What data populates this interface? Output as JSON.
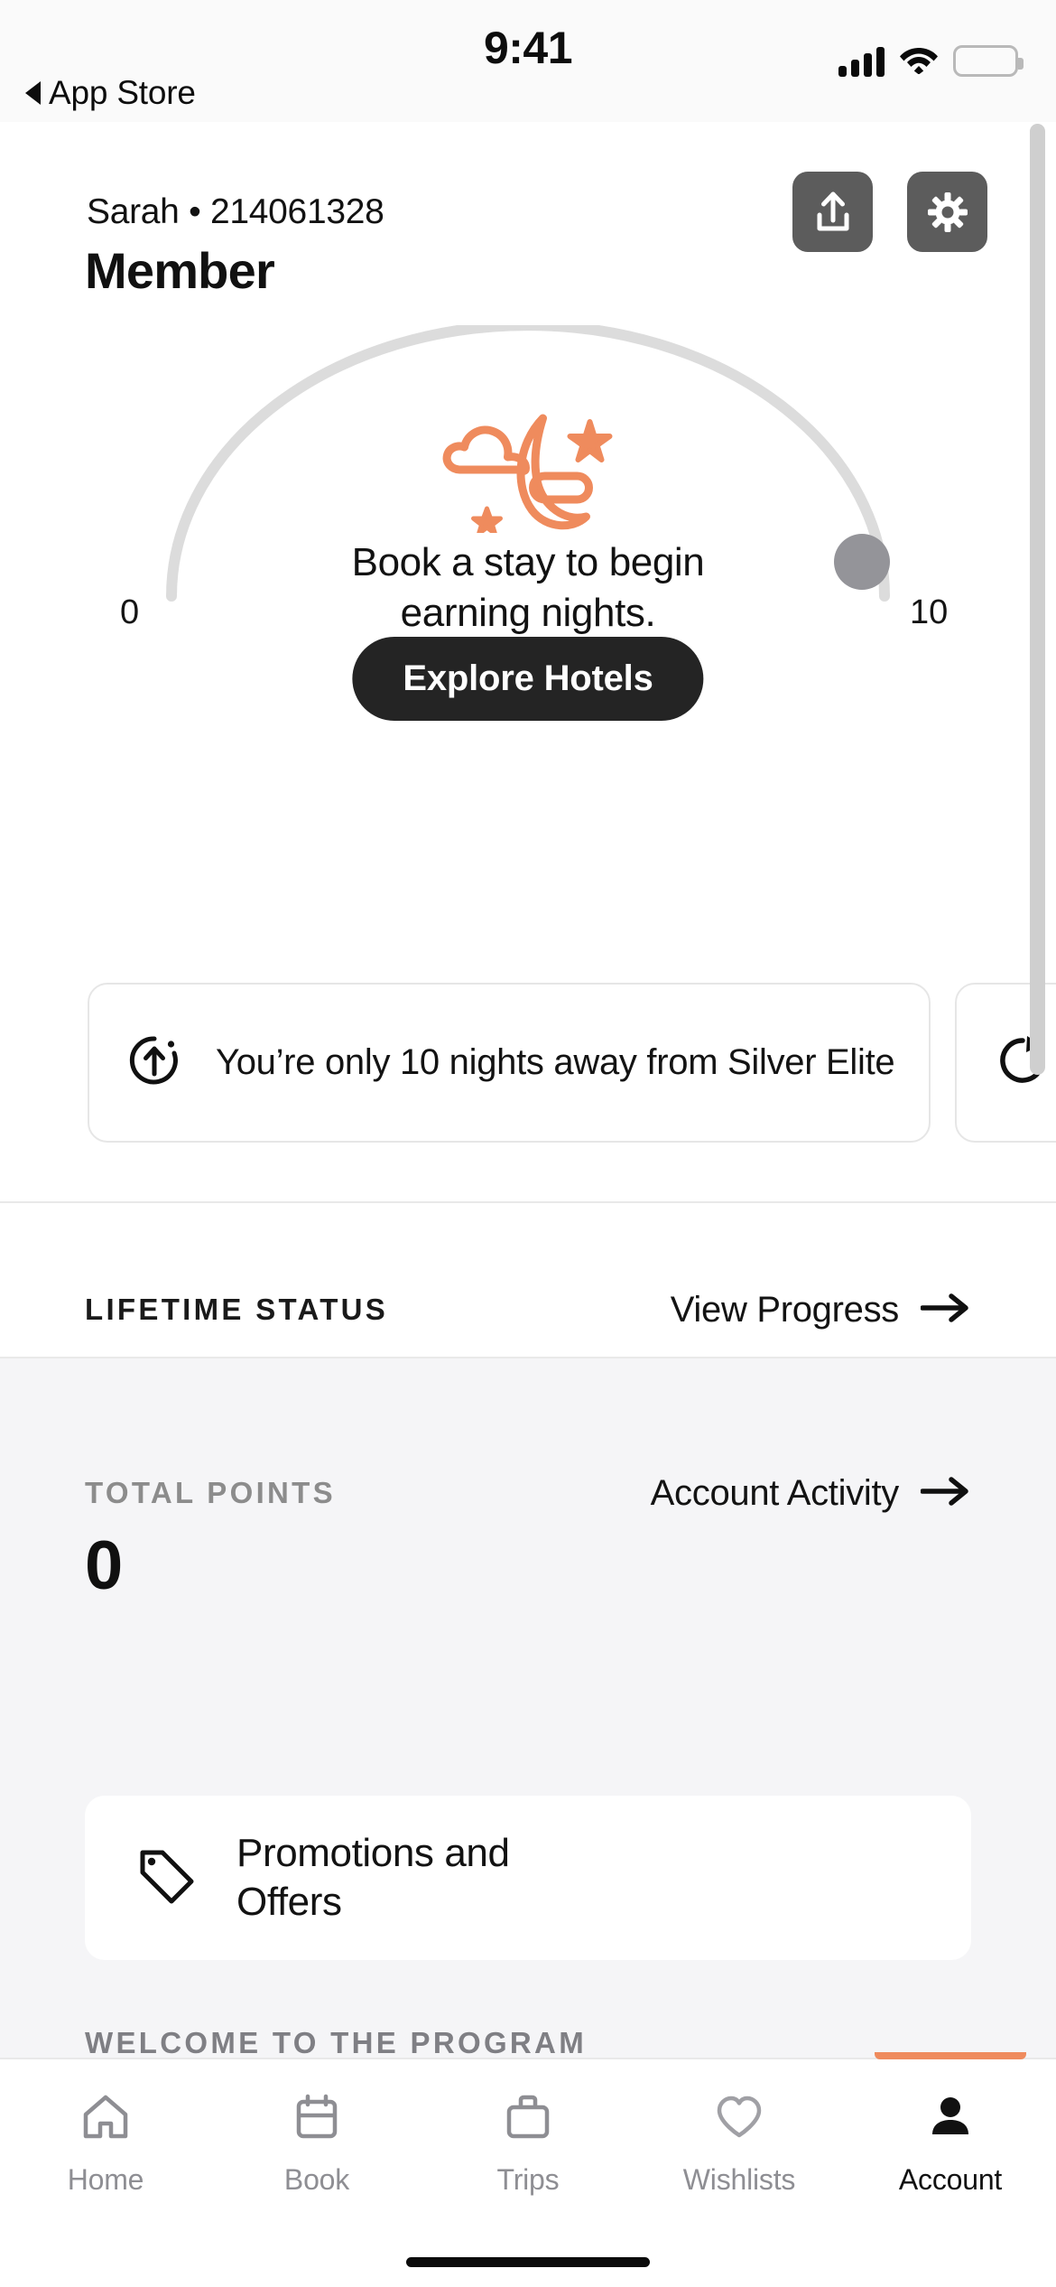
{
  "status_bar": {
    "time": "9:41",
    "back_label": "App Store",
    "back_icon": "triangle-left-icon",
    "signal_icon": "cellular-signal-icon",
    "wifi_icon": "wifi-icon",
    "battery_icon": "battery-full-icon"
  },
  "header": {
    "subtitle": "Sarah  •  214061328",
    "member_name": "Sarah",
    "member_number": "214061328",
    "title": "Member",
    "share_button": {
      "name": "share-button",
      "icon": "share-upload-icon"
    },
    "settings_button": {
      "name": "settings-button",
      "icon": "gear-icon"
    }
  },
  "gauge": {
    "illustration_icon": "crescent-moon-cloud-stars-icon",
    "message": "Book a stay to begin earning nights.",
    "message_line_1": "Book a stay to begin",
    "message_line_2": "earning nights.",
    "min_label": "0",
    "max_label": "10",
    "cta_label": "Explore Hotels",
    "accent_color": "#ef8b5d",
    "track_color": "#dcdcdc",
    "marker_color": "#949499"
  },
  "progress_cards": [
    {
      "icon": "upgrade-arrow-icon",
      "text": "You’re only 10 nights away from Silver Elite"
    },
    {
      "icon": "refresh-rotate-icon",
      "text": ""
    }
  ],
  "lifetime_status": {
    "kicker": "LIFETIME STATUS",
    "link_label": "View Progress",
    "link_icon": "arrow-right-icon"
  },
  "total_points": {
    "kicker": "TOTAL POINTS",
    "link_label": "Account Activity",
    "link_icon": "arrow-right-icon",
    "value": "0"
  },
  "promotions": {
    "icon": "tag-icon",
    "label_line_1": "Promotions and",
    "label_line_2": "Offers",
    "label": "Promotions and Offers"
  },
  "welcome": {
    "kicker": "WELCOME TO THE PROGRAM"
  },
  "tabbar": {
    "items": [
      {
        "label": "Home",
        "icon": "home-icon",
        "active": false
      },
      {
        "label": "Book",
        "icon": "calendar-icon",
        "active": false
      },
      {
        "label": "Trips",
        "icon": "briefcase-icon",
        "active": false
      },
      {
        "label": "Wishlists",
        "icon": "heart-icon",
        "active": false
      },
      {
        "label": "Account",
        "icon": "person-icon",
        "active": true
      }
    ],
    "active_indicator_color": "#ef8b5d"
  }
}
